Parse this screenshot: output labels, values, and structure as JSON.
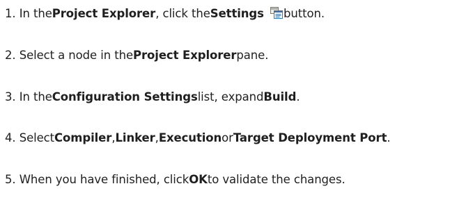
{
  "steps": [
    {
      "number": "1.",
      "pre": "In the",
      "bold1": "Project Explorer",
      "mid": ", click the",
      "bold2": "Settings",
      "icon": "settings-icon",
      "post": "button."
    },
    {
      "number": "2.",
      "pre": "Select a node in the",
      "bold1": "Project Explorer",
      "post": "pane."
    },
    {
      "number": "3.",
      "pre": "In the",
      "bold1": "Configuration Settings",
      "mid": "list, expand",
      "bold2": "Build",
      "post": "."
    },
    {
      "number": "4.",
      "pre": "Select",
      "bold1": "Compiler",
      "sep1": ",",
      "bold2": "Linker",
      "sep2": ",",
      "bold3": "Execution",
      "sep3": "or",
      "bold4": "Target Deployment Port",
      "post": "."
    },
    {
      "number": "5.",
      "pre": "When you have finished, click",
      "bold1": "OK",
      "post": "to validate the changes."
    }
  ],
  "colors": {
    "text": "#1f1f1f",
    "icon_accent": "#3b6fb6",
    "icon_paper": "#f3efe4"
  }
}
